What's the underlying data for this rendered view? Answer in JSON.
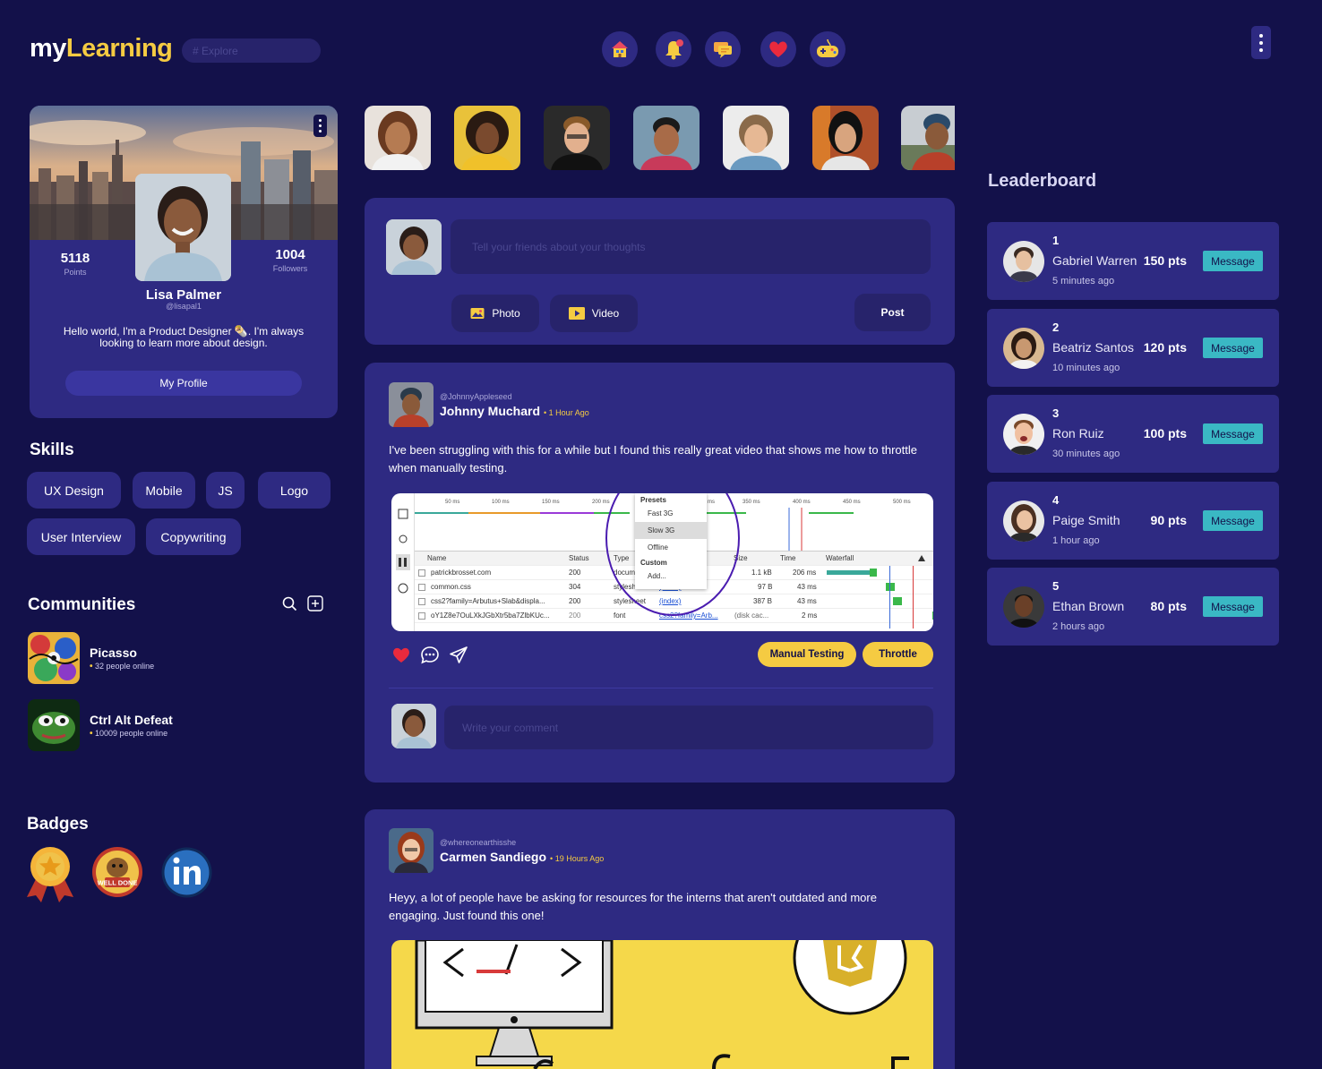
{
  "header": {
    "logo_my": "my",
    "logo_learning": "Learning",
    "search_placeholder": "# Explore",
    "nav_icons": [
      "home-icon",
      "bell-icon",
      "chat-icon",
      "heart-icon",
      "gamepad-icon"
    ]
  },
  "profile": {
    "points": "5118",
    "points_label": "Points",
    "followers": "1004",
    "followers_label": "Followers",
    "name": "Lisa Palmer",
    "handle": "@lisapal1",
    "bio": "Hello world, I'm a Product Designer 🌯. I'm always looking to learn more about design.",
    "button": "My Profile"
  },
  "skills": {
    "title": "Skills",
    "items": [
      "UX Design",
      "Mobile",
      "JS",
      "Logo",
      "User Interview",
      "Copywriting"
    ]
  },
  "communities": {
    "title": "Communities",
    "items": [
      {
        "name": "Picasso",
        "online": "32 people online"
      },
      {
        "name": "Ctrl Alt Defeat",
        "online": "10009 people online"
      }
    ]
  },
  "badges": {
    "title": "Badges",
    "items": [
      "medal-badge",
      "well-done-badge",
      "linkedin-badge"
    ],
    "well_done_text": "WELL DONE"
  },
  "composer": {
    "placeholder": "Tell your friends about your thoughts",
    "photo_label": "Photo",
    "video_label": "Video",
    "post_label": "Post"
  },
  "posts": [
    {
      "handle": "@JohnnyAppleseed",
      "name": "Johnny Muchard",
      "time": "1 Hour Ago",
      "text": "I've been struggling with this for a while but I found this really great video that shows me how to throttle when manually testing.",
      "tags": [
        "Manual Testing",
        "Throttle"
      ],
      "comment_placeholder": "Write your comment",
      "devtools": {
        "ticks": [
          "50 ms",
          "100 ms",
          "150 ms",
          "200 ms",
          "ms",
          "350 ms",
          "400 ms",
          "450 ms",
          "500 ms"
        ],
        "menu": {
          "presets": "Presets",
          "fast": "Fast 3G",
          "slow": "Slow 3G",
          "offline": "Offline",
          "custom": "Custom",
          "add": "Add..."
        },
        "columns": {
          "name": "Name",
          "status": "Status",
          "type": "Type",
          "size": "Size",
          "time": "Time",
          "waterfall": "Waterfall"
        },
        "rows": [
          {
            "name": "patrickbrosset.com",
            "status": "200",
            "type": "docum",
            "initiator": "",
            "size": "1.1 kB",
            "time": "206 ms"
          },
          {
            "name": "common.css",
            "status": "304",
            "type": "stylesheet",
            "initiator": "(index)",
            "size": "97 B",
            "time": "43 ms"
          },
          {
            "name": "css2?family=Arbutus+Slab&displa...",
            "status": "200",
            "type": "stylesheet",
            "initiator": "(index)",
            "size": "387 B",
            "time": "43 ms"
          },
          {
            "name": "oY1Z8e7OuLXkJGbXtr5ba7ZlbKUc...",
            "status": "200",
            "type": "font",
            "initiator": "css2?family=Arb...",
            "size": "(disk cac...",
            "time": "2 ms"
          }
        ]
      }
    },
    {
      "handle": "@whereonearthisshe",
      "name": "Carmen Sandiego",
      "time": "19 Hours Ago",
      "text": "Heyy, a lot of people have be asking for resources for the interns that aren't outdated and more engaging. Just found this one!"
    }
  ],
  "leaderboard": {
    "title": "Leaderboard",
    "message_label": "Message",
    "entries": [
      {
        "rank": "1",
        "name": "Gabriel Warren",
        "points": "150 pts",
        "time": "5 minutes ago"
      },
      {
        "rank": "2",
        "name": "Beatriz Santos",
        "points": "120 pts",
        "time": "10 minutes ago"
      },
      {
        "rank": "3",
        "name": "Ron Ruiz",
        "points": "100 pts",
        "time": "30 minutes ago"
      },
      {
        "rank": "4",
        "name": "Paige Smith",
        "points": "90 pts",
        "time": "1 hour ago"
      },
      {
        "rank": "5",
        "name": "Ethan Brown",
        "points": "80 pts",
        "time": "2 hours ago"
      }
    ]
  },
  "colors": {
    "background": "#13114a",
    "card": "#2e2a82",
    "accent_yellow": "#f5cb42",
    "message_button": "#3ab8c4"
  }
}
